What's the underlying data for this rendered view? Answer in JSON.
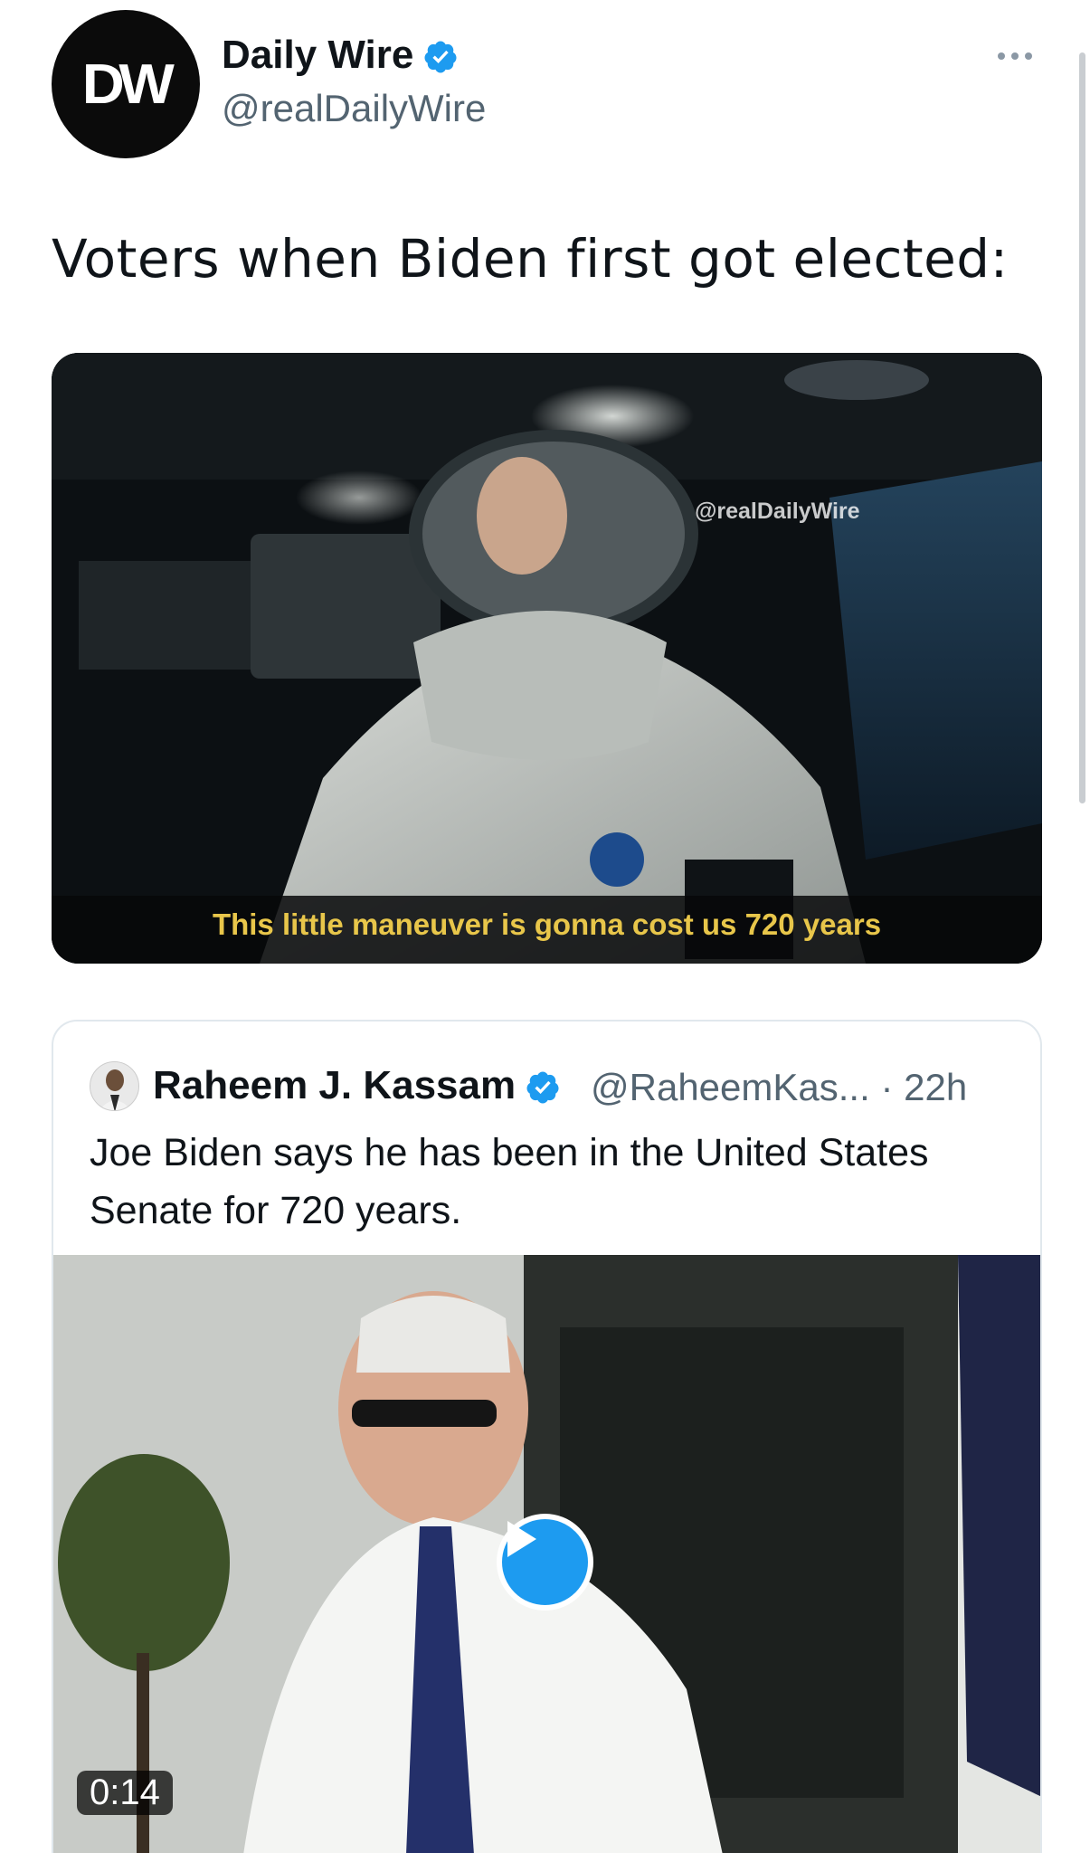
{
  "author": {
    "avatar_text": "DW",
    "name": "Daily Wire",
    "handle": "@realDailyWire",
    "verified": true
  },
  "tweet": {
    "text": "Voters when Biden first got elected:"
  },
  "media": {
    "watermark": "@realDailyWire",
    "caption": "This little maneuver is gonna cost us 720 years"
  },
  "quote": {
    "name": "Raheem J. Kassam",
    "handle": "@RaheemKas...",
    "separator": "·",
    "time": "22h",
    "text": "Joe Biden says he has been in the United States Senate for 720 years.",
    "video_duration": "0:14"
  },
  "icons": {
    "more": "more-horizontal-icon",
    "verified": "verified-badge-icon",
    "play": "play-icon"
  },
  "colors": {
    "verified_blue": "#1d9bf0",
    "secondary_text": "#536471",
    "caption_yellow": "#e8c64a"
  }
}
